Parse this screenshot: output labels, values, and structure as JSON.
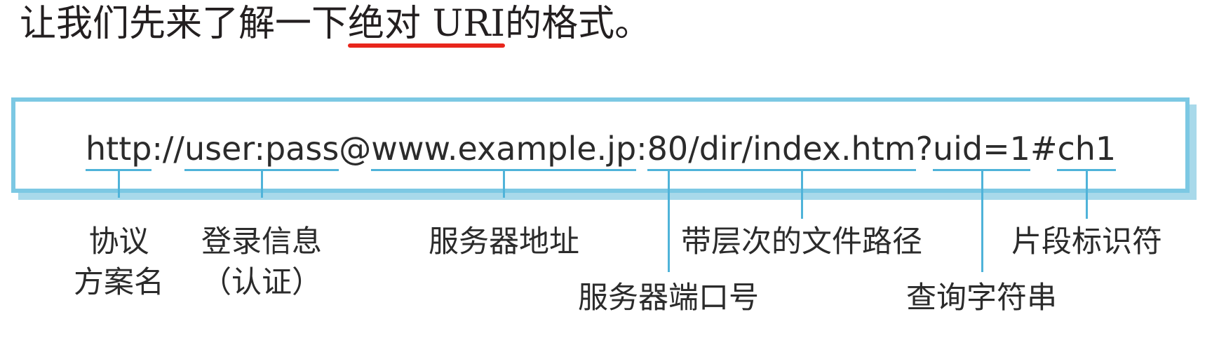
{
  "heading": {
    "before": "让我们先来了解一下",
    "highlight": "绝对 URI",
    "after": "的格式。",
    "underline_color": "#e8261c"
  },
  "box": {
    "border_color": "#7cc8e3",
    "leader_color": "#4fb3d9"
  },
  "uri": {
    "scheme": "http",
    "sep_scheme": "://",
    "credentials": "user:pass",
    "at": "@",
    "host": "www.example.jp",
    "colon": ":",
    "port": "80",
    "path": "/dir/index.htm",
    "qmark": "?",
    "query": "uid=1",
    "hash": "#",
    "fragment": "ch1"
  },
  "labels": {
    "scheme": [
      "协议",
      "方案名"
    ],
    "credentials": [
      "登录信息",
      "（认证）"
    ],
    "host": "服务器地址",
    "port": "服务器端口号",
    "path": "带层次的文件路径",
    "query": "查询字符串",
    "fragment": "片段标识符"
  }
}
